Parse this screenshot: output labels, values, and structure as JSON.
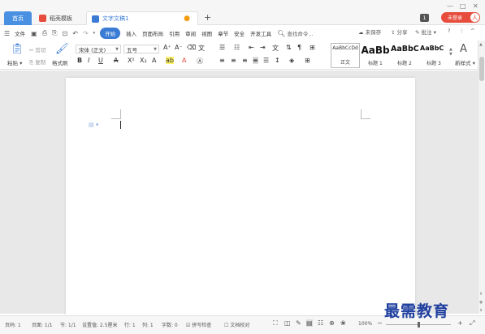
{
  "tabs": {
    "home": "首页",
    "template": "稻壳模板",
    "doc": "文字文稿1",
    "add": "+"
  },
  "window": {
    "minimize": "—",
    "restore": "□",
    "close": "✕",
    "badge": "1",
    "login": "未登录",
    "avatar": "人"
  },
  "menu": {
    "file": "文件",
    "items": [
      "开始",
      "插入",
      "页面布局",
      "引用",
      "审阅",
      "视图",
      "章节",
      "安全",
      "开发工具"
    ],
    "search": "查找命令...",
    "right": [
      "未保存",
      "分享",
      "批注",
      "?",
      "⋮",
      "^"
    ]
  },
  "ribbon": {
    "paste": "粘贴",
    "cut": "剪切",
    "copy": "复制",
    "format_painter": "格式刷",
    "font": "宋体 (正文)",
    "size": "五号",
    "styles": [
      {
        "preview": "AaBbCcDd",
        "label": "正文"
      },
      {
        "preview": "AaBb",
        "label": "标题 1"
      },
      {
        "preview": "AaBbC",
        "label": "标题 2"
      },
      {
        "preview": "AaBbC",
        "label": "标题 3"
      }
    ],
    "new_style": "新样式"
  },
  "status": {
    "page": "页码: 1",
    "pages": "页面: 1/1",
    "section": "节: 1/1",
    "setting": "设置值: 2.5厘米",
    "row": "行: 1",
    "col": "列: 1",
    "words": "字数: 0",
    "spell": "拼写检查",
    "proof": "文档校对",
    "zoom": "100%",
    "zoom_level": 1.0
  },
  "watermark": "最需教育",
  "colors": {
    "accent": "#3a7bd5",
    "login": "#e74c3c",
    "watermark": "#1f3f9f"
  }
}
